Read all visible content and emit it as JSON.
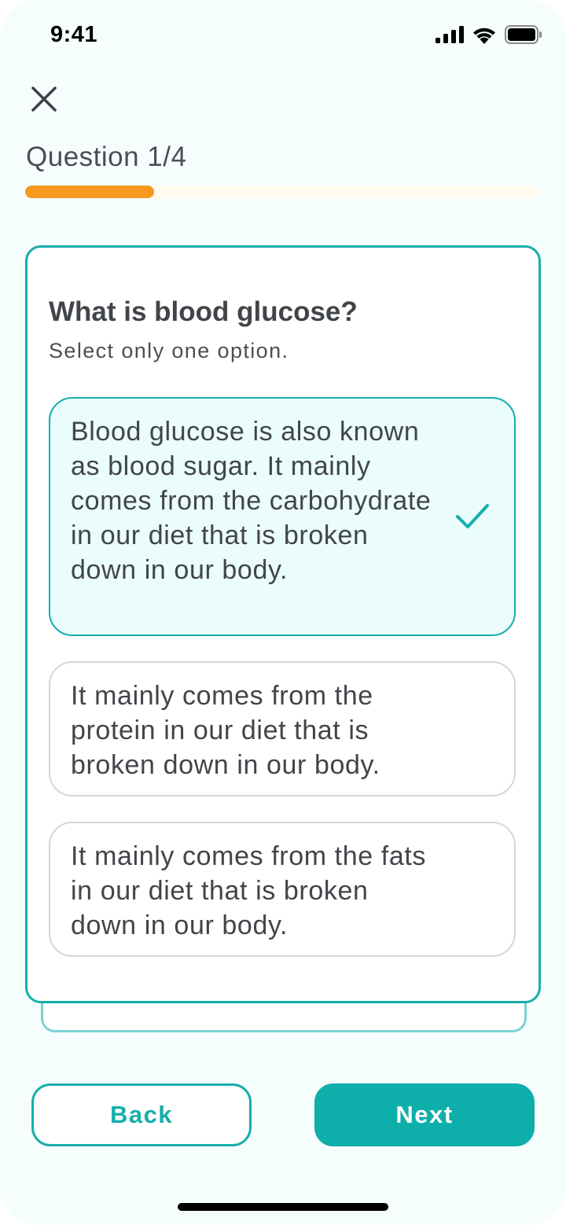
{
  "status_bar": {
    "time": "9:41",
    "icons": [
      "cellular-signal-icon",
      "wifi-icon",
      "battery-icon"
    ]
  },
  "header": {
    "close_icon": "close-icon",
    "question_counter": "Question 1/4",
    "progress": 0.25,
    "progress_color": "#f7981f",
    "progress_track_color": "#fffbee"
  },
  "question": {
    "title": "What is blood glucose?",
    "hint": "Select only one option.",
    "options": [
      {
        "text": "Blood glucose is also known as blood sugar. It mainly comes from the carbohydrate in our diet that is broken down in our body.",
        "selected": true
      },
      {
        "text": "It mainly comes from the protein in our diet that is broken down in our body.",
        "selected": false
      },
      {
        "text": "It mainly comes from the fats in our diet that is broken down in our body.",
        "selected": false
      }
    ],
    "selected_icon": "checkmark-icon"
  },
  "footer": {
    "back_label": "Back",
    "next_label": "Next"
  },
  "colors": {
    "accent": "#16aeaa",
    "selected_background": "#ebfcfc",
    "screen_background": "#f6fdfd"
  }
}
